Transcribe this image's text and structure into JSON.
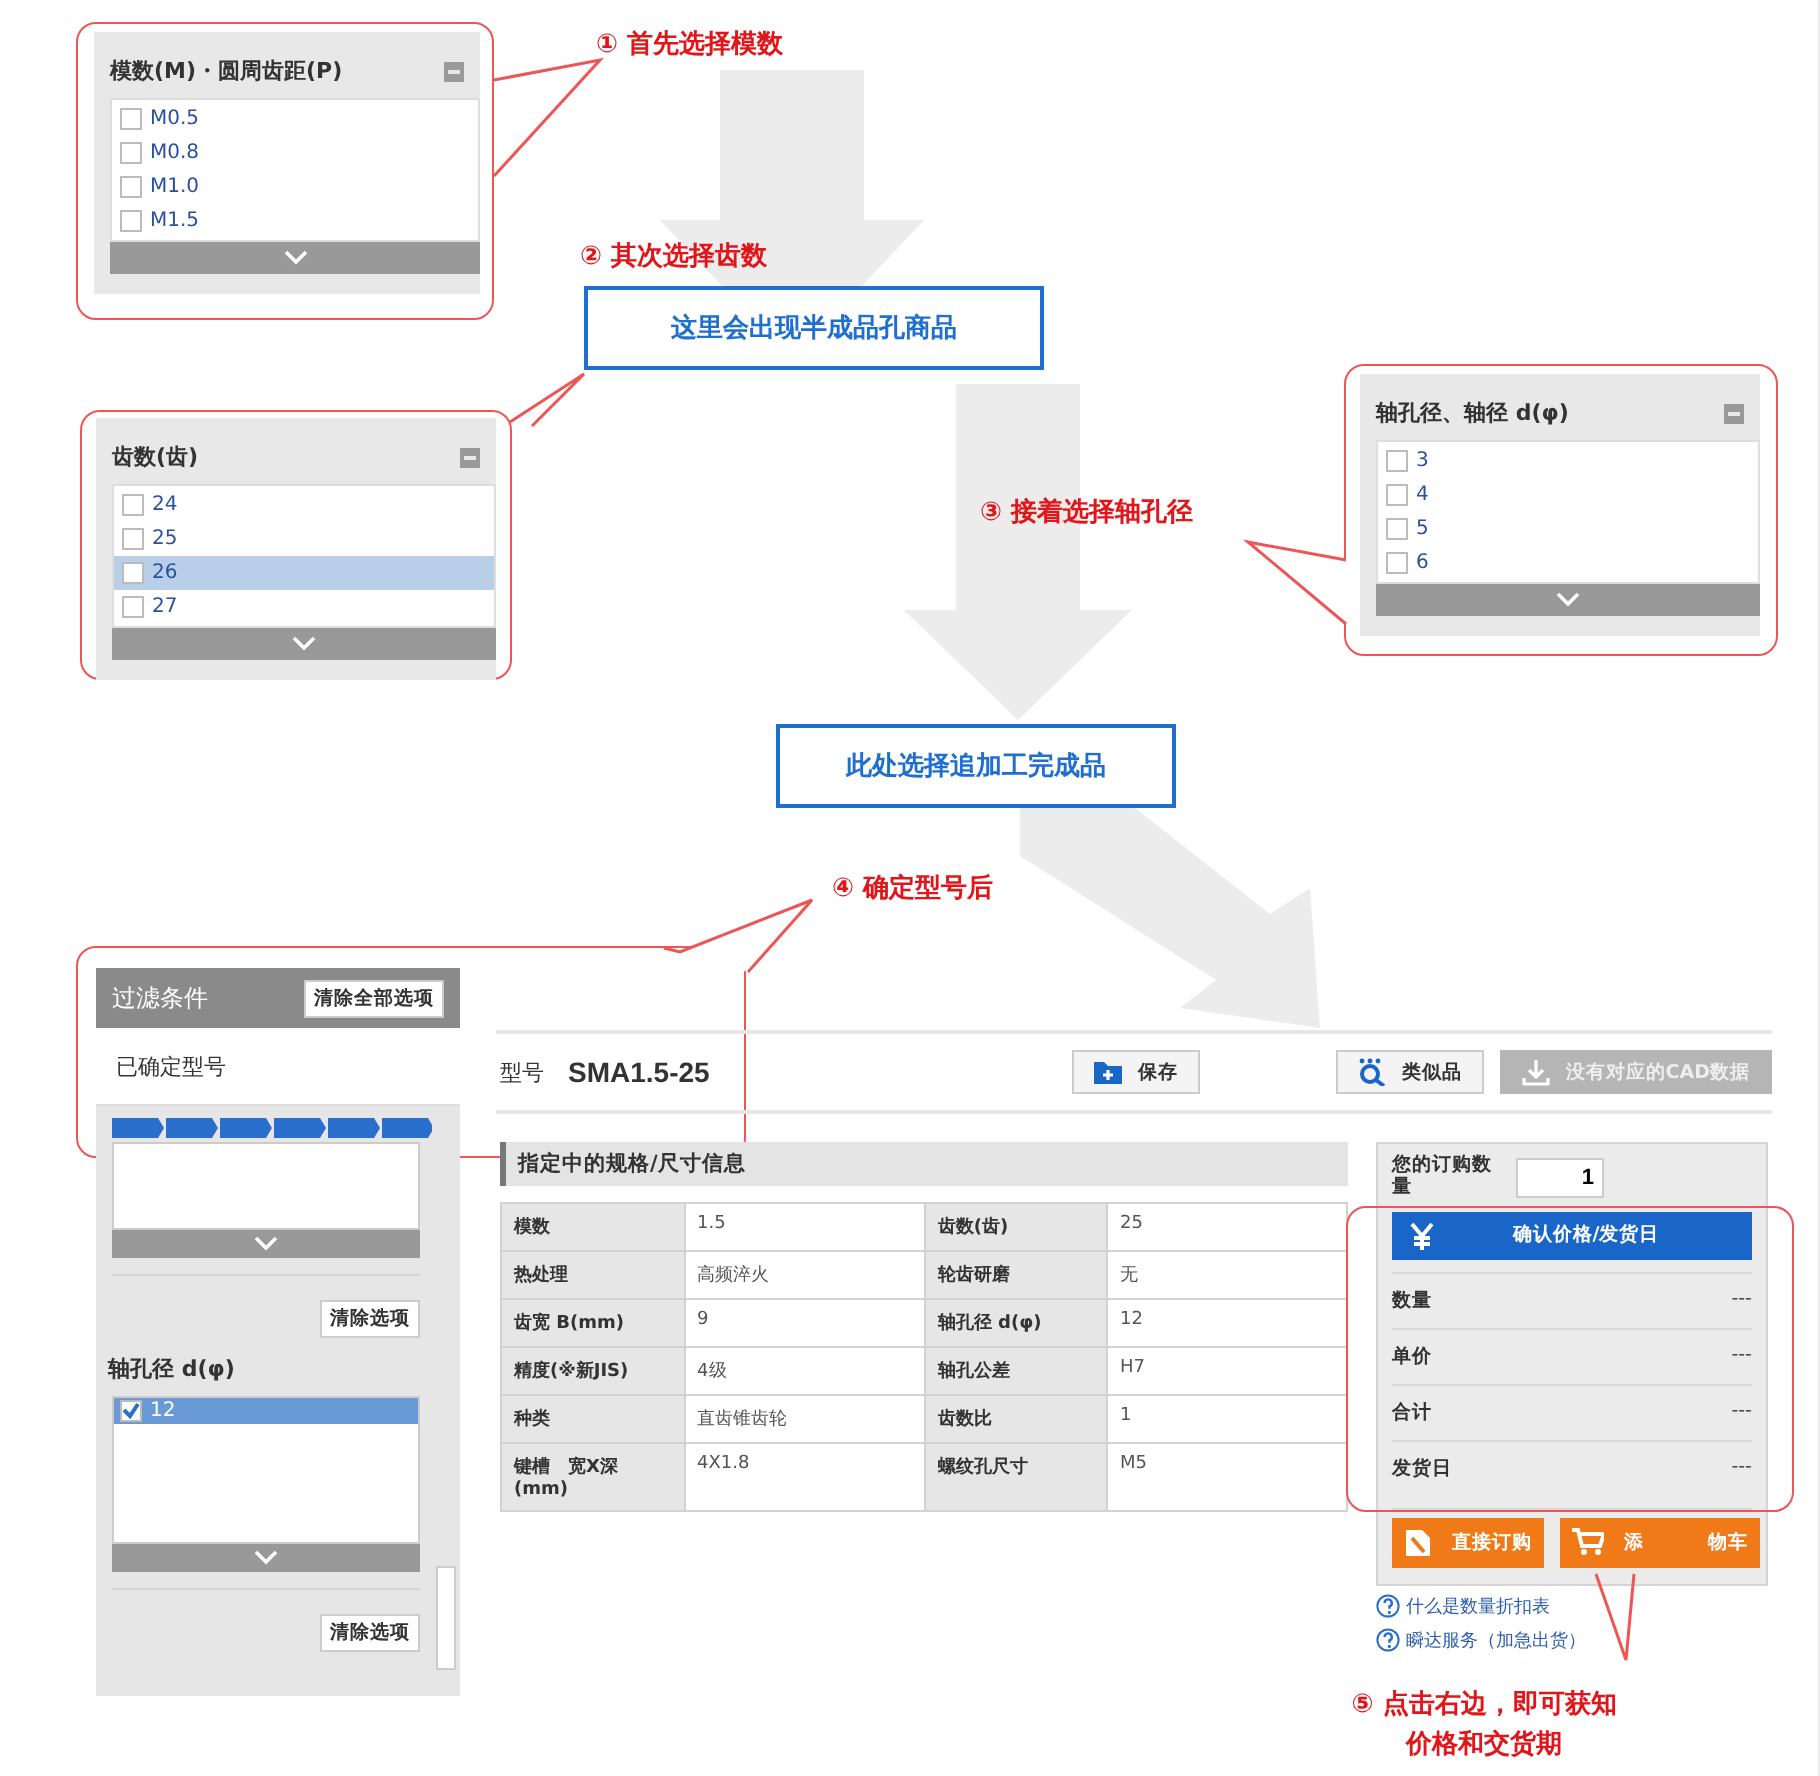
{
  "callouts": [
    {
      "number": "①",
      "text": "首先选择模数"
    },
    {
      "number": "②",
      "text": "其次选择齿数"
    },
    {
      "number": "③",
      "text": "接着选择轴孔径"
    },
    {
      "number": "④",
      "text": "确定型号后"
    },
    {
      "number": "⑤",
      "text": "点击右边，即可获知价格和交货期"
    }
  ],
  "notes": [
    "这里会出现半成品孔商品",
    "此处选择追加工完成品"
  ],
  "filter_panels": [
    {
      "title": "模数(M)・圆周齿距(P)",
      "items": [
        {
          "label": "M0.5",
          "checked": false,
          "selected": false
        },
        {
          "label": "M0.8",
          "checked": false,
          "selected": false
        },
        {
          "label": "M1.0",
          "checked": false,
          "selected": false
        },
        {
          "label": "M1.5",
          "checked": false,
          "selected": false
        }
      ]
    },
    {
      "title": "齿数(齿)",
      "items": [
        {
          "label": "24",
          "checked": false,
          "selected": false
        },
        {
          "label": "25",
          "checked": false,
          "selected": false
        },
        {
          "label": "26",
          "checked": false,
          "selected": true
        },
        {
          "label": "27",
          "checked": false,
          "selected": false
        }
      ]
    },
    {
      "title": "轴孔径、轴径 d(φ)",
      "items": [
        {
          "label": "3",
          "checked": false,
          "selected": false
        },
        {
          "label": "4",
          "checked": false,
          "selected": false
        },
        {
          "label": "5",
          "checked": false,
          "selected": false
        },
        {
          "label": "6",
          "checked": false,
          "selected": false
        }
      ]
    }
  ],
  "sidebar": {
    "title": "过滤条件",
    "clear_all": "清除全部选项",
    "status": "已确定型号",
    "sections": [
      {
        "clear": "清除选项"
      },
      {
        "title": "轴孔径 d(φ)",
        "items": [
          {
            "label": "12",
            "checked": true,
            "selected": true
          }
        ],
        "clear": "清除选项"
      }
    ]
  },
  "model": {
    "label": "型号",
    "value": "SMA1.5-25"
  },
  "toolbar": [
    {
      "label": "保存",
      "kind": "save",
      "disabled": false
    },
    {
      "label": "类似品",
      "kind": "similar",
      "disabled": false
    },
    {
      "label": "没有对应的CAD数据",
      "kind": "download",
      "disabled": true
    }
  ],
  "spec": {
    "title": "指定中的规格/尺寸信息",
    "rows": [
      [
        "模数",
        "1.5",
        "齿数(齿)",
        "25"
      ],
      [
        "热处理",
        "高频淬火",
        "轮齿研磨",
        "无"
      ],
      [
        "齿宽 B(mm)",
        "9",
        "轴孔径 d(φ)",
        "12"
      ],
      [
        "精度(※新JIS)",
        "4级",
        "轴孔公差",
        "H7"
      ],
      [
        "种类",
        "直齿锥齿轮",
        "齿数比",
        "1"
      ],
      [
        "键槽　宽X深(mm)",
        "4X1.8",
        "螺纹孔尺寸",
        "M5"
      ]
    ]
  },
  "order": {
    "qty_label": "您的订购数量",
    "qty": "1",
    "confirm": "确认价格/发货日",
    "rows": [
      {
        "label": "数量",
        "value": "---"
      },
      {
        "label": "单价",
        "value": "---"
      },
      {
        "label": "合计",
        "value": "---"
      },
      {
        "label": "发货日",
        "value": "---"
      }
    ],
    "buttons": [
      {
        "kind": "order",
        "parts": [
          "直接订购"
        ]
      },
      {
        "kind": "cart",
        "parts": [
          "添",
          "物车"
        ]
      }
    ],
    "links": [
      "什么是数量折扣表",
      "瞬达服务（加急出货）"
    ]
  }
}
